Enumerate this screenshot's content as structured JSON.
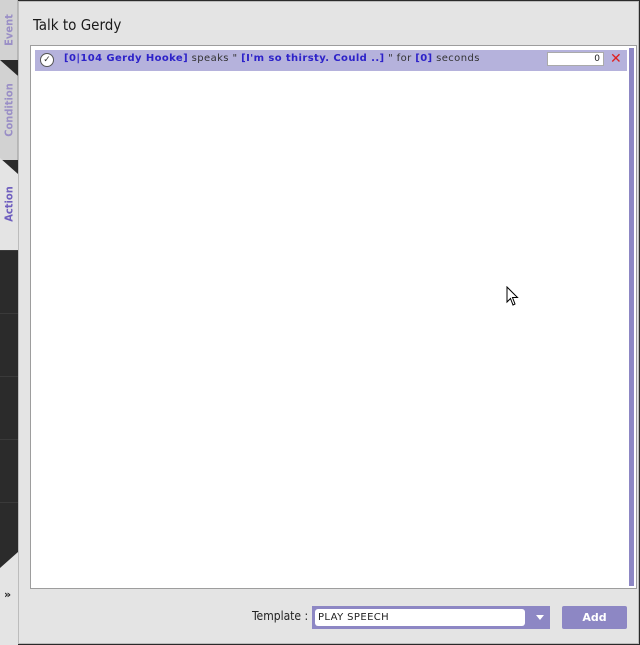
{
  "window": {
    "title": "Talk to Gerdy"
  },
  "side_tabs": [
    {
      "label": "Event"
    },
    {
      "label": "Condition"
    },
    {
      "label": "Action"
    }
  ],
  "expand_icon": "double-chevron-right-icon",
  "expand_glyph": "»",
  "actions": [
    {
      "check_icon": "checkmark-circle-icon",
      "check_glyph": "✓",
      "actor": "[0|104 Gerdy Hooke]",
      "verb": "speaks",
      "quote_open": "\"",
      "speech": "[I'm so thirsty. Could ..]",
      "quote_close": "\" for",
      "duration": "[0]",
      "unit": "seconds",
      "value": "0",
      "delete_icon": "close-x-icon",
      "delete_glyph": "✕"
    }
  ],
  "footer": {
    "template_label": "Template :",
    "template_value": "PLAY SPEECH",
    "add_label": "Add"
  },
  "colors": {
    "accent": "#8d87c4",
    "row_highlight": "#b5b2dc",
    "param_text": "#2d22c9",
    "delete": "#e02020"
  }
}
